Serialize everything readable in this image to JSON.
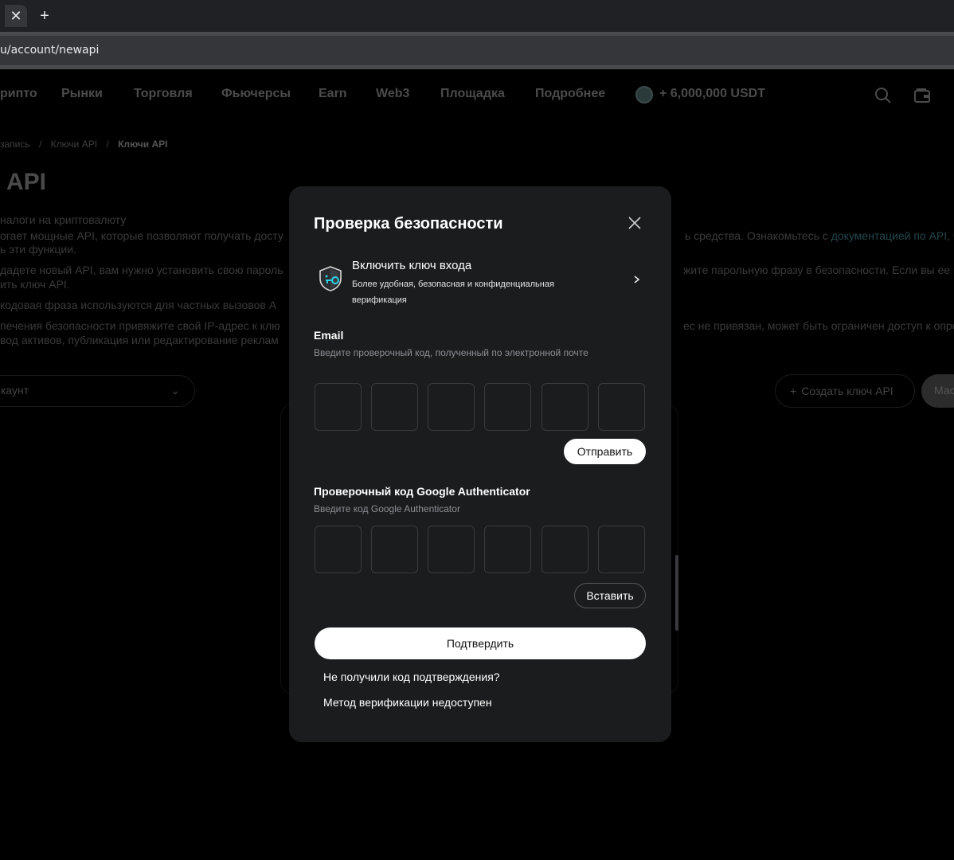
{
  "browser": {
    "tab_close_glyph": "✕",
    "new_tab_glyph": "+",
    "url": "u/account/newapi"
  },
  "nav": {
    "items": [
      "рипто",
      "Рынки",
      "Торговля",
      "Фьючерсы",
      "Earn",
      "Web3",
      "Площадка",
      "Подробнее"
    ],
    "promo": "+ 6,000,000 USDT",
    "icons": [
      "search-icon",
      "wallet-icon"
    ]
  },
  "breadcrumb": {
    "items": [
      "запись",
      "Ключи API"
    ],
    "current": "Ключи API",
    "separator": "/"
  },
  "page": {
    "title": "API",
    "lines": [
      "налоги на криптовалюту",
      "огает мощные API, которые позволяют получать досту",
      "ь эти функции.",
      "дадете новый API, вам нужно установить свою пароль",
      "ить ключ API.",
      "кодовая фраза используются для частных вызовов А",
      "печения безопасности привяжите свой IP-адрес к клю",
      "вод активов, публикация или редактирование реклам"
    ],
    "right_lines": [
      "ь средства. Ознакомьтесь с ",
      "жите парольную фразу в безопасности. Если вы ее п",
      "ес не привязан, может быть ограничен доступ к опре"
    ],
    "docs_link": "документацией по API",
    "docs_suffix": ", ч",
    "account_select": "каунт",
    "create_button": "Создать ключ API",
    "more_button": "Мас"
  },
  "modal": {
    "title": "Проверка безопасности",
    "passkey": {
      "title": "Включить ключ входа",
      "description": "Более удобная, безопасная и конфиденциальная верификация"
    },
    "email": {
      "label": "Email",
      "hint": "Введите проверочный код, полученный по электронной почте",
      "send_button": "Отправить"
    },
    "google": {
      "label": "Проверочный код Google Authenticator",
      "hint": "Введите код Google Authenticator",
      "paste_button": "Вставить"
    },
    "confirm_button": "Подтвердить",
    "links": [
      "Не получили код подтверждения?",
      "Метод верификации недоступен"
    ]
  }
}
